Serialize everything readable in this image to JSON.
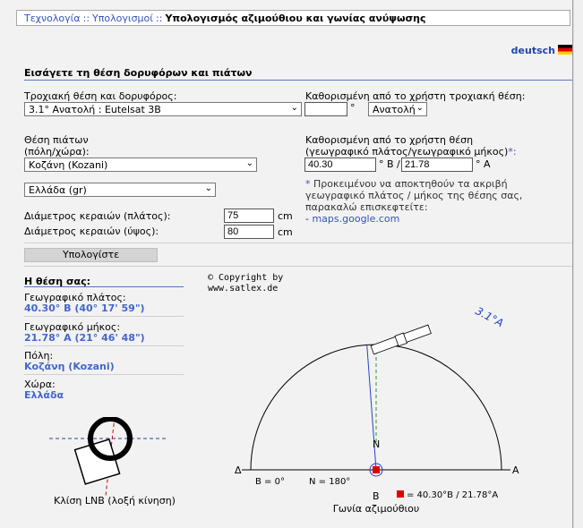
{
  "breadcrumb": {
    "item1": "Τεχνολογία",
    "sep": "::",
    "item2": "Υπολογισμοί",
    "current": "Υπολογισμός αζιμούθιου και γωνίας ανύψωσης"
  },
  "language_link": "deutsch",
  "section_title": "Εισάγετε τη θέση δορυφόρων και πιάτων",
  "orbit": {
    "label": "Τροχιακή θέση και δορυφόρος:",
    "selected": "3.1° Ανατολή : Eutelsat 3B",
    "user_label": "Καθορισμένη από το χρήστη τροχιακή θέση:",
    "user_value": "",
    "deg": "°",
    "direction": "Ανατολή"
  },
  "dish": {
    "label_line1": "Θέση πιάτων",
    "label_line2": "(πόλη/χώρα):",
    "city": "Κοζάνη (Kozani)",
    "country": "Ελλάδα (gr)",
    "user_label_line1": "Καθορισμένη από το χρήστη θέση",
    "user_label_line2": "(γεωγραφικό πλάτος/γεωγραφικό μήκος)",
    "user_label_star": "*:",
    "lat": "40.30",
    "lat_suffix": "° Β /",
    "lon": "21.78",
    "lon_suffix": "° Α"
  },
  "note": {
    "star": "*",
    "text": " Προκειμένου να αποκτηθούν τα ακριβή γεωγραφικό πλάτος / μήκος της θέσης σας, παρακαλώ επισκεφτείτε:",
    "link": "maps.google.com",
    "dash": "- "
  },
  "antenna": {
    "width_label": "Διάμετρος κεραιών (πλάτος):",
    "width_value": "75",
    "height_label": "Διάμετρος κεραιών (ύψος):",
    "height_value": "80",
    "unit": "cm"
  },
  "calculate_button": "Υπολογίστε",
  "position": {
    "title": "Η θέση σας:",
    "lat_label": "Γεωγραφικό πλάτος:",
    "lat_value": "40.30° Β (40° 17' 59\")",
    "lon_label": "Γεωγραφικό μήκος:",
    "lon_value": "21.78° Α (21° 46' 48\")",
    "city_label": "Πόλη:",
    "city_value": "Κοζάνη (Kozani)",
    "country_label": "Χώρα:",
    "country_value": "Ελλάδα"
  },
  "copyright_line1": "© Copyright by",
  "copyright_line2": "www.satlex.de",
  "azimuth": {
    "satellite_label": "3.1°A",
    "west": "Δ",
    "east": "Α",
    "north": "Ν",
    "south": "Β",
    "b_label": "B = 0°",
    "n_label": "N = 180°",
    "legend": "= 40.30°B / 21.78°A",
    "caption": "Γωνία αζιμούθιου",
    "satellite_azimuth_deg": 175.8
  },
  "lnb_caption": "Κλίση LNB (λοξή κίνηση)",
  "colors": {
    "link": "#3355bb",
    "value": "#4466cc",
    "marker": "#dd0000",
    "section_line": "#5577bb"
  }
}
